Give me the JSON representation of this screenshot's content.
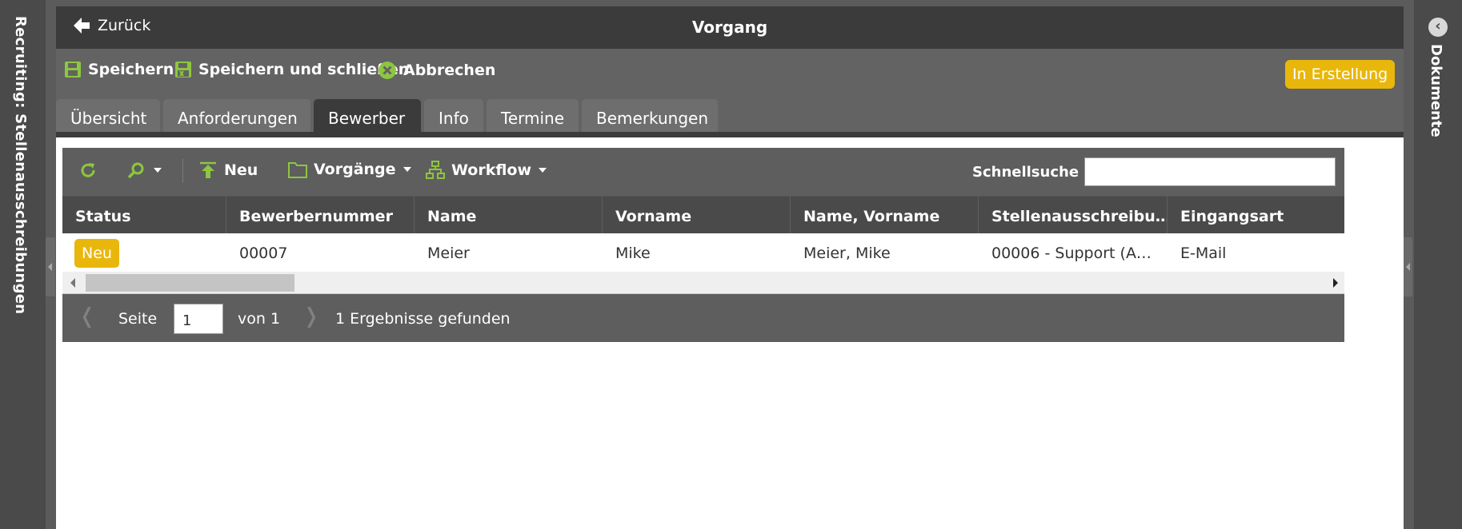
{
  "left_panel": {
    "label": "Recruiting: Stellenausschreibungen"
  },
  "right_panel": {
    "label": "Dokumente",
    "collapse_icon": "chevron-left-icon"
  },
  "header": {
    "back_label": "Zurück",
    "title": "Vorgang"
  },
  "actions": {
    "save": "Speichern",
    "save_close": "Speichern und schließen",
    "cancel": "Abbrechen",
    "status_badge": "In Erstellung"
  },
  "tabs": [
    {
      "label": "Übersicht"
    },
    {
      "label": "Anforderungen"
    },
    {
      "label": "Bewerber",
      "active": true
    },
    {
      "label": "Info"
    },
    {
      "label": "Termine"
    },
    {
      "label": "Bemerkungen"
    }
  ],
  "grid": {
    "toolbar": {
      "new_label": "Neu",
      "processes_label": "Vorgänge",
      "workflow_label": "Workflow",
      "quicksearch_label": "Schnellsuche",
      "quicksearch_value": ""
    },
    "columns": [
      "Status",
      "Bewerbernummer",
      "Name",
      "Vorname",
      "Name, Vorname",
      "Stellenausschreibu…",
      "Eingangsart"
    ],
    "rows": [
      {
        "status": "Neu",
        "bewerbernummer": "00007",
        "name": "Meier",
        "vorname": "Mike",
        "name_vorname": "Meier, Mike",
        "stelle": "00006 - Support (A…",
        "eingangsart": "E-Mail"
      }
    ],
    "pager": {
      "page_label": "Seite",
      "page_value": "1",
      "of_label": "von 1",
      "results": "1 Ergebnisse gefunden"
    }
  },
  "colors": {
    "accent_green": "#8dc63f",
    "badge_yellow": "#e9b70c",
    "dark_bar": "#3b3b3b",
    "toolbar_grey": "#636363"
  }
}
